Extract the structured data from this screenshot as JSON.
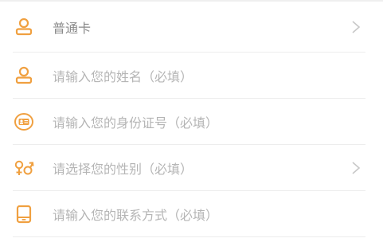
{
  "colors": {
    "accent": "#f0a040",
    "placeholder": "#b5b5b5",
    "value": "#8a8a8a",
    "divider": "#ededed"
  },
  "rows": [
    {
      "icon": "user-icon",
      "text": "普通卡",
      "chevron": true
    },
    {
      "icon": "user-icon",
      "text": "请输入您的姓名（必填）",
      "chevron": false
    },
    {
      "icon": "id-card-icon",
      "text": "请输入您的身份证号（必填）",
      "chevron": false
    },
    {
      "icon": "gender-icon",
      "text": "请选择您的性别（必填）",
      "chevron": true
    },
    {
      "icon": "phone-icon",
      "text": "请输入您的联系方式（必填）",
      "chevron": false
    }
  ]
}
